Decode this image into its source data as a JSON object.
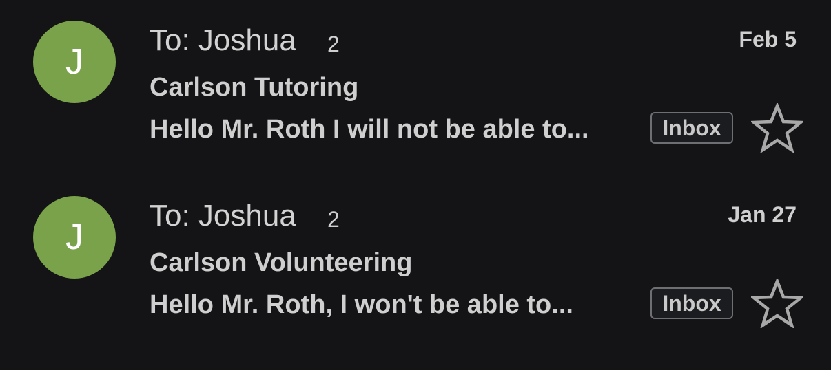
{
  "emails": [
    {
      "avatar_letter": "J",
      "avatar_color": "#79a24b",
      "sender": "To: Joshua",
      "count": "2",
      "date": "Feb 5",
      "subject": "Carlson Tutoring",
      "snippet": "Hello Mr. Roth I will not be able to...",
      "label": "Inbox",
      "starred": false
    },
    {
      "avatar_letter": "J",
      "avatar_color": "#79a24b",
      "sender": "To: Joshua",
      "count": "2",
      "date": "Jan 27",
      "subject": "Carlson Volunteering",
      "snippet": "Hello Mr. Roth, I won't be able to...",
      "label": "Inbox",
      "starred": false
    }
  ],
  "icons": {
    "star": "star-outline-icon"
  }
}
